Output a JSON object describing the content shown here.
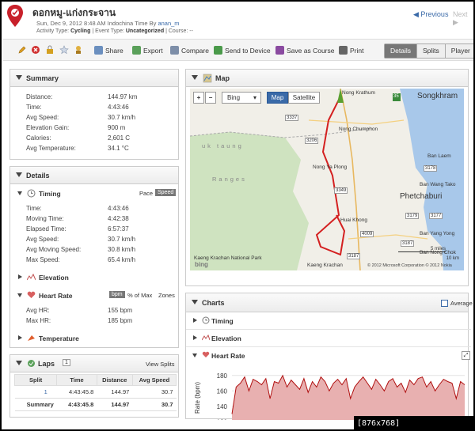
{
  "header": {
    "title": "ดอกหมู-แก่งกระจาน",
    "date_line_prefix": "Sun, Dec 9, 2012 8:48 AM Indochina Time By",
    "user": "anan_m",
    "activity_label": "Activity Type:",
    "activity_type": "Cycling",
    "event_label": "| Event Type:",
    "event_type": "Uncategorized",
    "course_label": "| Course:",
    "course": "--",
    "prev": "◀ Previous",
    "next": "Next ▶"
  },
  "toolbar": {
    "share": "Share",
    "export": "Export",
    "compare": "Compare",
    "send": "Send to Device",
    "save_course": "Save as Course",
    "print": "Print",
    "views": [
      "Details",
      "Splits",
      "Player"
    ],
    "active_view": "Details"
  },
  "summary": {
    "title": "Summary",
    "rows": [
      {
        "k": "Distance:",
        "v": "144.97 km"
      },
      {
        "k": "Time:",
        "v": "4:43:46"
      },
      {
        "k": "Avg Speed:",
        "v": "30.7 km/h"
      },
      {
        "k": "Elevation Gain:",
        "v": "900 m"
      },
      {
        "k": "Calories:",
        "v": "2,601 C"
      },
      {
        "k": "Avg Temperature:",
        "v": "34.1 °C"
      }
    ]
  },
  "details": {
    "title": "Details",
    "timing": {
      "label": "Timing",
      "pace": "Pace",
      "speed": "Speed",
      "rows": [
        {
          "k": "Time:",
          "v": "4:43:46"
        },
        {
          "k": "Moving Time:",
          "v": "4:42:38"
        },
        {
          "k": "Elapsed Time:",
          "v": "6:57:37"
        },
        {
          "k": "Avg Speed:",
          "v": "30.7 km/h"
        },
        {
          "k": "Avg Moving Speed:",
          "v": "30.8 km/h"
        },
        {
          "k": "Max Speed:",
          "v": "65.4 km/h"
        }
      ]
    },
    "elevation": "Elevation",
    "heart_rate": {
      "label": "Heart Rate",
      "bpm": "bpm",
      "pct": "% of Max",
      "zones": "Zones",
      "rows": [
        {
          "k": "Avg HR:",
          "v": "155 bpm"
        },
        {
          "k": "Max HR:",
          "v": "185 bpm"
        }
      ]
    },
    "temperature": "Temperature"
  },
  "laps": {
    "title": "Laps",
    "count": "1",
    "view_splits": "View Splits",
    "headers": [
      "Split",
      "Time",
      "Distance",
      "Avg Speed"
    ],
    "rows": [
      [
        "1",
        "4:43:45.8",
        "144.97",
        "30.7"
      ],
      [
        "Summary",
        "4:43:45.8",
        "144.97",
        "30.7"
      ]
    ]
  },
  "map": {
    "title": "Map",
    "provider": "Bing",
    "map_btn": "Map",
    "sat_btn": "Satellite",
    "zoom_in": "+",
    "zoom_out": "−",
    "labels": [
      "Nong Krathum",
      "Songkhram",
      "Nong Chumphon",
      "Ban Laem",
      "Nong Ya Plong",
      "Ban Wang Tako",
      "Phetchaburi",
      "Huai Khong",
      "Ban Yang Yong",
      "Ban Nong Chok",
      "Kaeng Krachan",
      "Kaeng Krachan National Park",
      "Ranges",
      "uk taung"
    ],
    "roads": [
      "3337",
      "3206",
      "3349",
      "4009",
      "3187",
      "3178",
      "3179",
      "3187",
      "35",
      "3177"
    ],
    "scale_miles": "5 miles",
    "scale_km": "10 km",
    "copyright": "© 2012 Microsoft Corporation © 2012 Nokia",
    "brand": "bing"
  },
  "charts": {
    "title": "Charts",
    "average": "Average",
    "rows": [
      "Timing",
      "Elevation",
      "Heart Rate"
    ]
  },
  "chart_data": {
    "type": "area",
    "ylabel": "Rate (bpm)",
    "yticks": [
      120,
      140,
      160,
      180
    ],
    "ylim": [
      110,
      190
    ],
    "values": [
      130,
      165,
      170,
      178,
      160,
      175,
      172,
      168,
      176,
      150,
      172,
      170,
      180,
      165,
      174,
      168,
      162,
      176,
      158,
      172,
      165,
      178,
      172,
      160,
      170,
      175,
      168,
      176,
      150,
      165,
      172,
      178,
      170,
      162,
      175,
      168,
      160,
      172,
      176,
      165,
      170,
      158,
      174,
      168,
      176,
      178,
      165,
      172,
      160,
      168,
      175,
      172,
      170,
      150,
      172,
      168
    ]
  },
  "watermark": "[876x768] https://upic.me/",
  "colors": {
    "accent": "#3a6aa8",
    "route": "#d42020",
    "hr_fill": "#e8b0b0",
    "hr_line": "#b01010"
  }
}
